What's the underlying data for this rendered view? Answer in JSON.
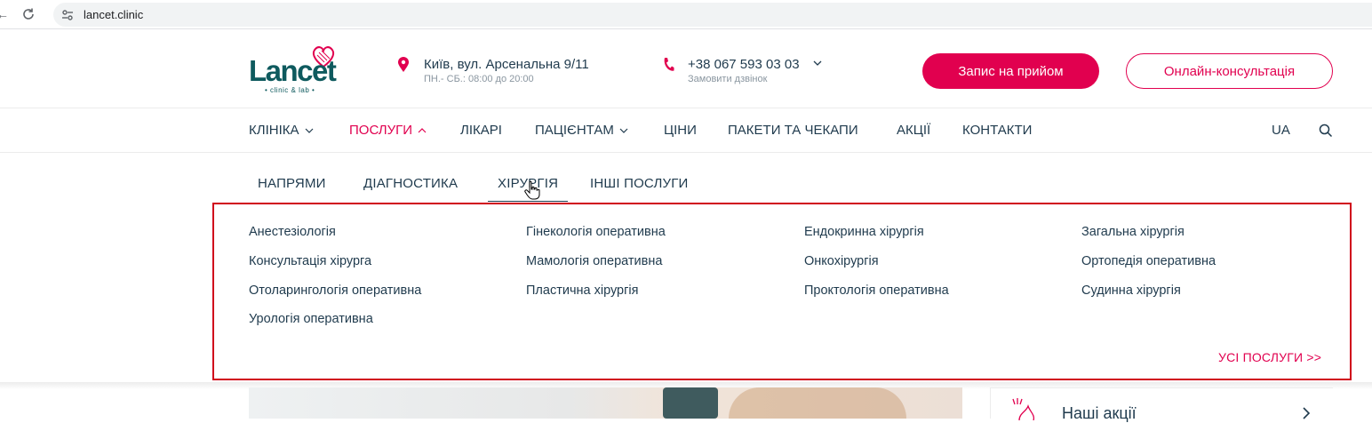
{
  "browser": {
    "url": "lancet.clinic"
  },
  "header": {
    "logo_text": "Lancet",
    "logo_sub": "• clinic & lab •",
    "address": "Київ, вул. Арсенальна 9/11",
    "hours": "ПН.- СБ.: 08:00 до 20:00",
    "phone": "+38 067 593 03 03",
    "callback": "Замовити дзвінок",
    "appointment_button": "Запис на прийом",
    "online_button": "Онлайн-консультація"
  },
  "nav": {
    "items": [
      {
        "label": "КЛІНІКА",
        "has_dropdown": true,
        "active": false
      },
      {
        "label": "ПОСЛУГИ",
        "has_dropdown": true,
        "active": true
      },
      {
        "label": "ЛІКАРІ",
        "has_dropdown": false,
        "active": false
      },
      {
        "label": "ПАЦІЄНТАМ",
        "has_dropdown": true,
        "active": false
      },
      {
        "label": "ЦІНИ",
        "has_dropdown": false,
        "active": false
      },
      {
        "label": "ПАКЕТИ ТА ЧЕКАПИ",
        "has_dropdown": false,
        "active": false
      },
      {
        "label": "АКЦІЇ",
        "has_dropdown": false,
        "active": false
      },
      {
        "label": "КОНТАКТИ",
        "has_dropdown": false,
        "active": false
      }
    ],
    "language": "UA"
  },
  "submenu": {
    "tabs": [
      "НАПРЯМИ",
      "ДІАГНОСТИКА",
      "ХІРУРГІЯ",
      "ІНШІ ПОСЛУГИ"
    ],
    "active_tab": "ХІРУРГІЯ",
    "services": [
      "Анестезіологія",
      "Гінекологія оперативна",
      "Ендокринна хірургія",
      "Загальна хірургія",
      "Консультація хірурга",
      "Мамологія оперативна",
      "Онкохірургія",
      "Ортопедія оперативна",
      "Отоларингологія оперативна",
      "Пластична хірургія",
      "Проктологія оперативна",
      "Судинна хірургія",
      "Урологія оперативна"
    ],
    "all_services_link": "УСІ ПОСЛУГИ >>"
  },
  "promo": {
    "label": "Наші акції"
  },
  "colors": {
    "brand_pink": "#e1004f",
    "brand_teal": "#0e5a5e",
    "text": "#1f3a4d",
    "highlight_border": "#d0021b"
  }
}
